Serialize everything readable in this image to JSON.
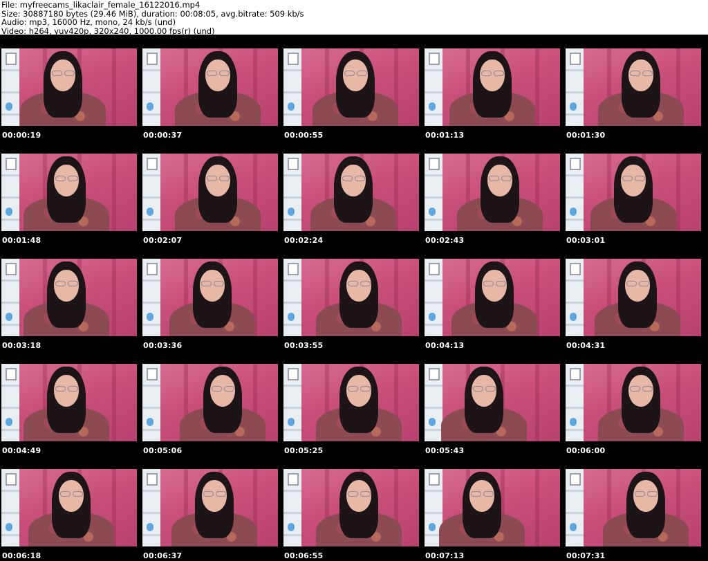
{
  "header": {
    "line1": "File: myfreecams_likaclair_female_16122016.mp4",
    "line2": "Size: 30887180 bytes (29.46 MiB), duration: 00:08:05, avg.bitrate: 509 kb/s",
    "line3": "Audio: mp3, 16000 Hz, mono, 24 kb/s (und)",
    "line4": "Video: h264, yuv420p, 320x240, 1000.00 fps(r) (und)"
  },
  "thumbnails": [
    {
      "time": "00:00:19"
    },
    {
      "time": "00:00:37"
    },
    {
      "time": "00:00:55"
    },
    {
      "time": "00:01:13"
    },
    {
      "time": "00:01:30"
    },
    {
      "time": "00:01:48"
    },
    {
      "time": "00:02:07"
    },
    {
      "time": "00:02:24"
    },
    {
      "time": "00:02:43"
    },
    {
      "time": "00:03:01"
    },
    {
      "time": "00:03:18"
    },
    {
      "time": "00:03:36"
    },
    {
      "time": "00:03:55"
    },
    {
      "time": "00:04:13"
    },
    {
      "time": "00:04:31"
    },
    {
      "time": "00:04:49"
    },
    {
      "time": "00:05:06"
    },
    {
      "time": "00:05:25"
    },
    {
      "time": "00:05:43"
    },
    {
      "time": "00:06:00"
    },
    {
      "time": "00:06:18"
    },
    {
      "time": "00:06:37"
    },
    {
      "time": "00:06:55"
    },
    {
      "time": "00:07:13"
    },
    {
      "time": "00:07:31"
    }
  ]
}
